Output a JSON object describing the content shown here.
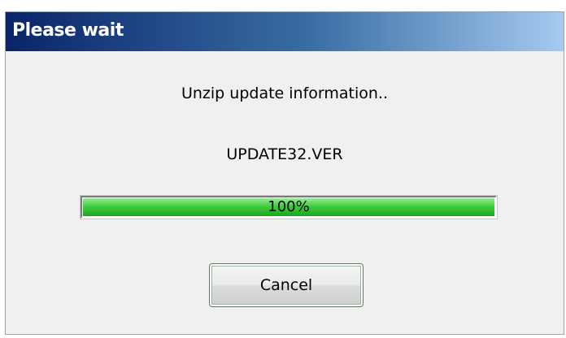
{
  "dialog": {
    "title": "Please wait",
    "status_message": "Unzip update information..",
    "file_name": "UPDATE32.VER",
    "progress": {
      "value": 1.0,
      "label": "100%",
      "fill_color": "#3fcd3f"
    },
    "cancel_label": "Cancel"
  }
}
